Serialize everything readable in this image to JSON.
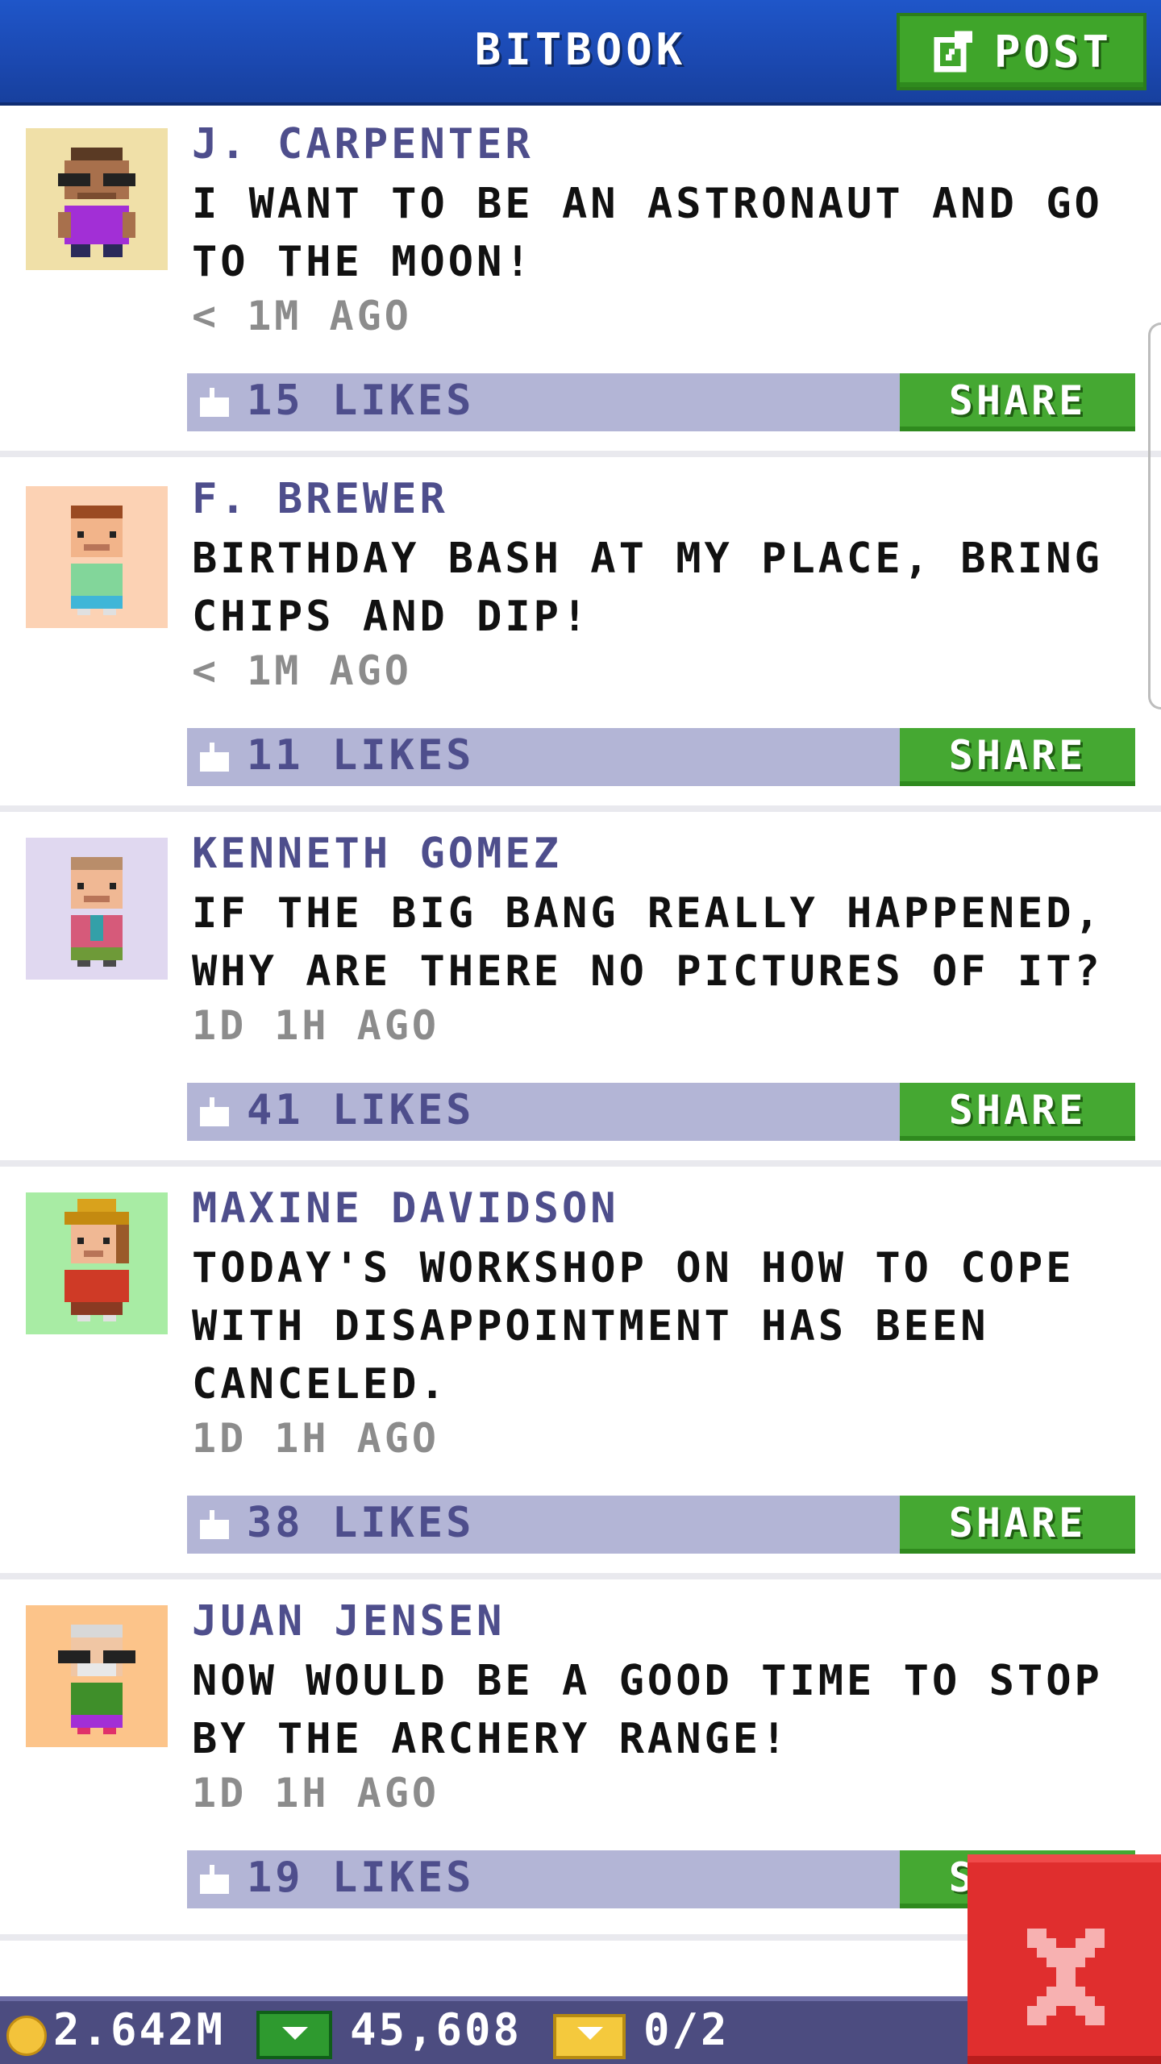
{
  "header": {
    "title": "BITBOOK",
    "post_label": "POST",
    "post_icon": "edit-icon"
  },
  "posts": [
    {
      "author": "J. CARPENTER",
      "message": "I WANT TO BE AN ASTRONAUT AND GO TO THE MOON!",
      "time": "< 1M AGO",
      "likes": "15 LIKES",
      "share": "SHARE",
      "avatar_bg": "#f0e0a8"
    },
    {
      "author": "F. BREWER",
      "message": "BIRTHDAY BASH AT MY PLACE, BRING CHIPS AND DIP!",
      "time": "< 1M AGO",
      "likes": "11 LIKES",
      "share": "SHARE",
      "avatar_bg": "#fcd2b4"
    },
    {
      "author": "KENNETH GOMEZ",
      "message": "IF THE BIG BANG REALLY HAPPENED, WHY ARE THERE NO PICTURES OF IT?",
      "time": "1D 1H AGO",
      "likes": "41 LIKES",
      "share": "SHARE",
      "avatar_bg": "#e0d8f0"
    },
    {
      "author": "MAXINE DAVIDSON",
      "message": "TODAY'S WORKSHOP ON HOW TO COPE WITH DISAPPOINTMENT HAS BEEN CANCELED.",
      "time": "1D 1H AGO",
      "likes": "38 LIKES",
      "share": "SHARE",
      "avatar_bg": "#a8eca4"
    },
    {
      "author": "JUAN JENSEN",
      "message": "NOW WOULD BE A GOOD TIME TO STOP BY THE ARCHERY RANGE!",
      "time": "1D 1H AGO",
      "likes": "19 LIKES",
      "share": "SHARE",
      "avatar_bg": "#fcc48a"
    }
  ],
  "bottom_bar": {
    "coins": "2.642M",
    "bux": "45,608",
    "tickets": "0/2"
  },
  "colors": {
    "header_blue": "#1b48b0",
    "share_green": "#45a832",
    "like_bar": "#b3b5d6",
    "close_red": "#e02e2e"
  }
}
